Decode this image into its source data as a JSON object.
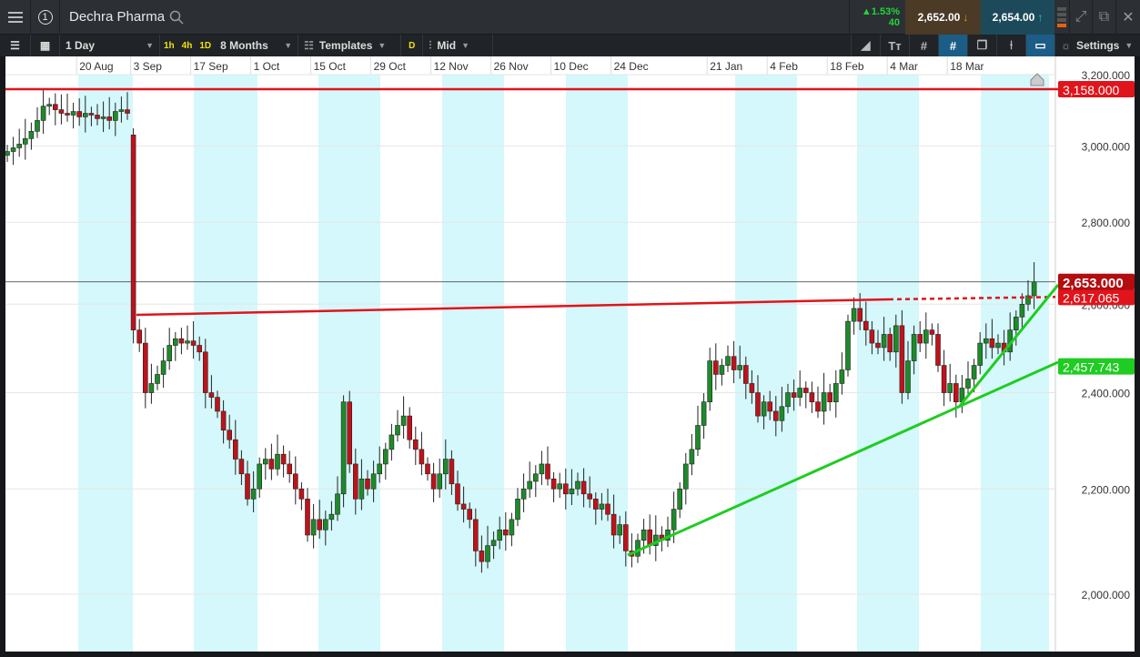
{
  "header": {
    "title": "Dechra Pharma",
    "menu_icon": "hamburger-icon",
    "workspace": "1",
    "change_pct": "▲1.53%",
    "change_abs": "40",
    "sell": "2,652.00",
    "buy": "2,654.00"
  },
  "toolbar": {
    "interval": "1 Day",
    "q1": "1h",
    "q2": "4h",
    "q3": "1D",
    "range": "8 Months",
    "templates": "Templates",
    "d": "D",
    "price_type": "Mid",
    "settings": "Settings"
  },
  "colors": {
    "up": "#1e8a2a",
    "down": "#c0121b",
    "band": "#d4f8fb",
    "resistance": "#e0141b",
    "support": "#1fcc22"
  },
  "chart_data": {
    "type": "candlestick",
    "title": "Dechra Pharma",
    "scale": "log",
    "ylim": [
      1960,
      3240
    ],
    "yticks": [
      "3,200.000",
      "3,000.000",
      "2,800.000",
      "2,600.000",
      "2,400.000",
      "2,200.000",
      "2,000.000"
    ],
    "ytick_values": [
      3200,
      3000,
      2800,
      2600,
      2400,
      2200,
      2000
    ],
    "xticks": [
      "20 Aug",
      "3 Sep",
      "17 Sep",
      "1 Oct",
      "15 Oct",
      "29 Oct",
      "12 Nov",
      "26 Nov",
      "10 Dec",
      "24 Dec",
      "21 Jan",
      "4 Feb",
      "18 Feb",
      "4 Mar",
      "18 Mar"
    ],
    "xtick_index": [
      12,
      21,
      31,
      41,
      51,
      61,
      71,
      81,
      91,
      101,
      117,
      127,
      137,
      147,
      157
    ],
    "first_open": 2975,
    "gap_open_index": 21,
    "gap_open": 3030,
    "closes": [
      2985,
      2995,
      3005,
      3020,
      3040,
      3070,
      3110,
      3115,
      3100,
      3090,
      3085,
      3095,
      3080,
      3090,
      3085,
      3075,
      3080,
      3070,
      3095,
      3100,
      3090,
      2540,
      2510,
      2400,
      2420,
      2440,
      2470,
      2505,
      2520,
      2510,
      2515,
      2505,
      2490,
      2400,
      2390,
      2360,
      2320,
      2300,
      2260,
      2230,
      2180,
      2200,
      2250,
      2260,
      2240,
      2270,
      2250,
      2230,
      2200,
      2180,
      2110,
      2140,
      2120,
      2140,
      2150,
      2190,
      2380,
      2250,
      2180,
      2220,
      2200,
      2230,
      2250,
      2280,
      2310,
      2330,
      2350,
      2300,
      2280,
      2250,
      2230,
      2200,
      2230,
      2260,
      2210,
      2170,
      2160,
      2140,
      2080,
      2060,
      2090,
      2100,
      2120,
      2110,
      2140,
      2180,
      2200,
      2215,
      2230,
      2250,
      2220,
      2200,
      2210,
      2190,
      2200,
      2215,
      2190,
      2180,
      2160,
      2170,
      2150,
      2110,
      2130,
      2080,
      2070,
      2100,
      2120,
      2090,
      2110,
      2100,
      2120,
      2160,
      2200,
      2250,
      2280,
      2330,
      2380,
      2470,
      2440,
      2460,
      2480,
      2450,
      2460,
      2420,
      2400,
      2350,
      2380,
      2360,
      2340,
      2370,
      2400,
      2390,
      2410,
      2400,
      2380,
      2360,
      2400,
      2380,
      2420,
      2450,
      2560,
      2590,
      2560,
      2540,
      2510,
      2500,
      2530,
      2490,
      2550,
      2400,
      2470,
      2530,
      2510,
      2540,
      2530,
      2460,
      2400,
      2420,
      2380,
      2410,
      2430,
      2460,
      2510,
      2520,
      2500,
      2510,
      2490,
      2540,
      2570,
      2600,
      2620,
      2653
    ],
    "levels": {
      "current": "2,653.000",
      "resistance_h": "3,158.000",
      "resistance_trend": "2,617.065",
      "support_trend": "2,457.743"
    },
    "level_values": {
      "current": 2653,
      "resistance_h": 3158,
      "resistance_trend": 2617.065,
      "support_trend": 2457.743
    }
  }
}
